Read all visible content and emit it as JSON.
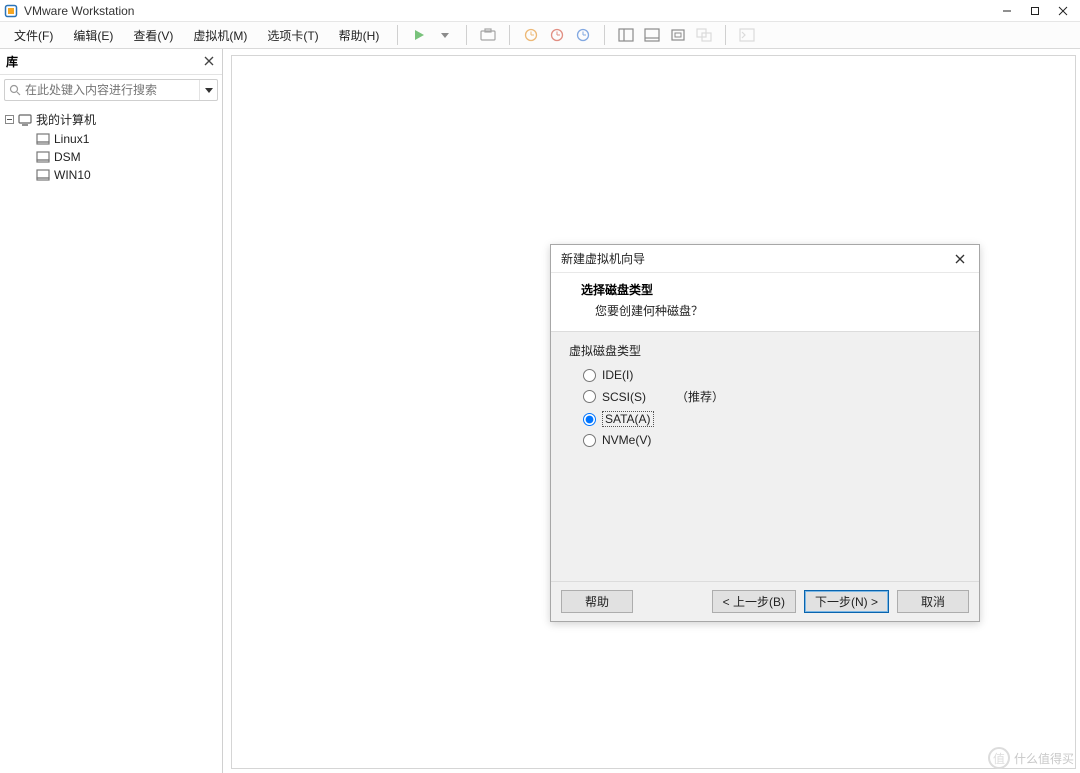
{
  "window": {
    "title": "VMware Workstation"
  },
  "menu": {
    "file": "文件(F)",
    "edit": "编辑(E)",
    "view": "查看(V)",
    "vm": "虚拟机(M)",
    "tabs": "选项卡(T)",
    "help": "帮助(H)"
  },
  "sidebar": {
    "title": "库",
    "search_placeholder": "在此处键入内容进行搜索",
    "root_label": "我的计算机",
    "items": [
      {
        "label": "Linux1"
      },
      {
        "label": "DSM"
      },
      {
        "label": "WIN10"
      }
    ]
  },
  "dialog": {
    "title": "新建虚拟机向导",
    "heading": "选择磁盘类型",
    "subheading": "您要创建何种磁盘？",
    "group_label": "虚拟磁盘类型",
    "options": {
      "ide": "IDE(I)",
      "scsi": "SCSI(S)",
      "scsi_extra": "（推荐）",
      "sata": "SATA(A)",
      "nvme": "NVMe(V)"
    },
    "selected": "sata",
    "buttons": {
      "help": "帮助",
      "back": "< 上一步(B)",
      "next": "下一步(N) >",
      "cancel": "取消"
    }
  },
  "watermark": "什么值得买"
}
